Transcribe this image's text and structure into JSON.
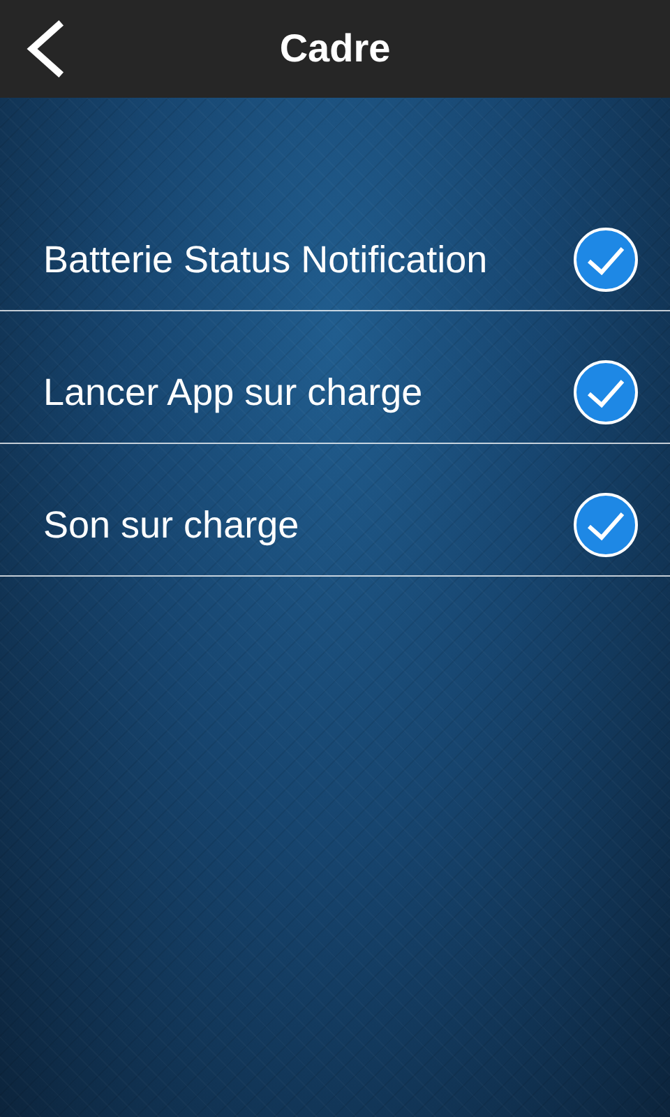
{
  "header": {
    "title": "Cadre"
  },
  "settings": [
    {
      "label": "Batterie Status Notification",
      "checked": true
    },
    {
      "label": "Lancer App sur charge",
      "checked": true
    },
    {
      "label": "Son sur charge",
      "checked": true
    }
  ]
}
